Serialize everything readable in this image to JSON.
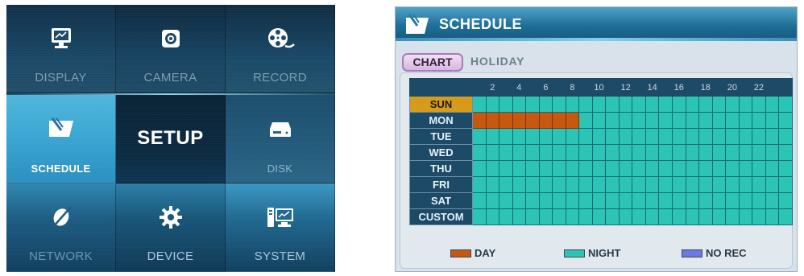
{
  "setup_menu": {
    "center_label": "SETUP",
    "tiles": [
      {
        "id": "display",
        "label": "DISPLAY",
        "icon": "monitor-icon"
      },
      {
        "id": "camera",
        "label": "CAMERA",
        "icon": "camera-icon"
      },
      {
        "id": "record",
        "label": "RECORD",
        "icon": "film-reel-icon"
      },
      {
        "id": "schedule",
        "label": "SCHEDULE",
        "icon": "schedule-icon",
        "selected": true
      },
      {
        "id": "disk",
        "label": "DISK",
        "icon": "disk-icon"
      },
      {
        "id": "network",
        "label": "NETWORK",
        "icon": "network-icon"
      },
      {
        "id": "device",
        "label": "DEVICE",
        "icon": "gear-icon"
      },
      {
        "id": "system",
        "label": "SYSTEM",
        "icon": "system-icon"
      }
    ]
  },
  "schedule": {
    "title": "SCHEDULE",
    "tabs": [
      {
        "label": "CHART",
        "active": true
      },
      {
        "label": "HOLIDAY",
        "active": false
      }
    ],
    "hours": [
      "",
      "2",
      "",
      "4",
      "",
      "6",
      "",
      "8",
      "",
      "10",
      "",
      "12",
      "",
      "14",
      "",
      "16",
      "",
      "18",
      "",
      "20",
      "",
      "22",
      "",
      ""
    ],
    "days": [
      "SUN",
      "MON",
      "TUE",
      "WED",
      "THU",
      "FRI",
      "SAT",
      "CUSTOM"
    ],
    "selected_day": "SUN",
    "day_cells": {
      "MON": [
        0,
        1,
        2,
        3,
        4,
        5,
        6,
        7
      ]
    },
    "default_mode": "NIGHT",
    "legend": [
      {
        "label": "DAY",
        "color": "#c8570f"
      },
      {
        "label": "NIGHT",
        "color": "#2cc4b4"
      },
      {
        "label": "NO REC",
        "color": "#6b7ae0"
      }
    ]
  }
}
